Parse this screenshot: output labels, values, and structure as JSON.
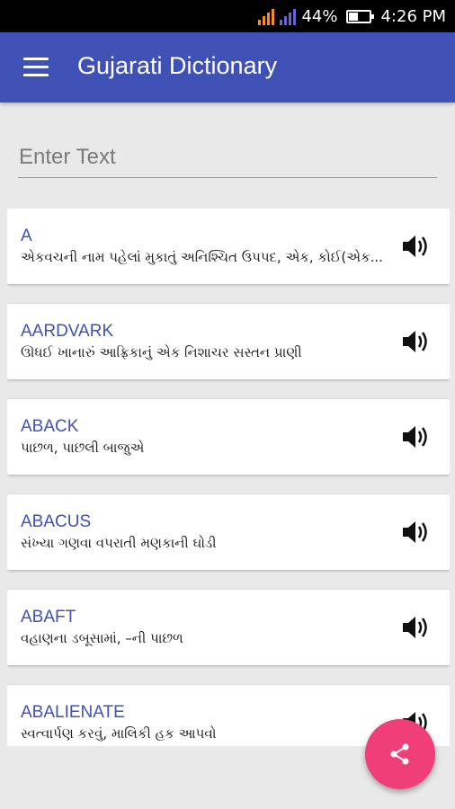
{
  "status_bar": {
    "battery": "44%",
    "time": "4:26 PM",
    "battery_level": 0.44
  },
  "app_bar": {
    "title": "Gujarati Dictionary",
    "menu_icon": "hamburger-menu-icon"
  },
  "search": {
    "placeholder": "Enter Text",
    "value": ""
  },
  "entries": [
    {
      "word": "A",
      "meaning": "એકવચની નામ પહેલાં મુકાતું અનિશ્ચિત ઉપપદ, એક, કોઈ(એક..."
    },
    {
      "word": "AARDVARK",
      "meaning": "ઊધઈ ખાનારું આફ્રિકાનું એક નિશાચર સસ્તન પ્રાણી"
    },
    {
      "word": "ABACK",
      "meaning": "પાછળ, પાછલી બાજુએ"
    },
    {
      "word": "ABACUS",
      "meaning": "સંખ્યા ગણવા વપરાતી મણકાની ઘોડી"
    },
    {
      "word": "ABAFT",
      "meaning": "વહાણના ડબૂસામાં, –ની પાછળ"
    },
    {
      "word": "ABALIENATE",
      "meaning": "સ્વત્વાર્પણ કરવું, માલિકી હક આપવો"
    }
  ],
  "icons": {
    "speaker": "speaker-icon",
    "share": "share-icon"
  },
  "colors": {
    "primary": "#3f51b5",
    "accent": "#f03e78",
    "background": "#e9e9e9"
  }
}
